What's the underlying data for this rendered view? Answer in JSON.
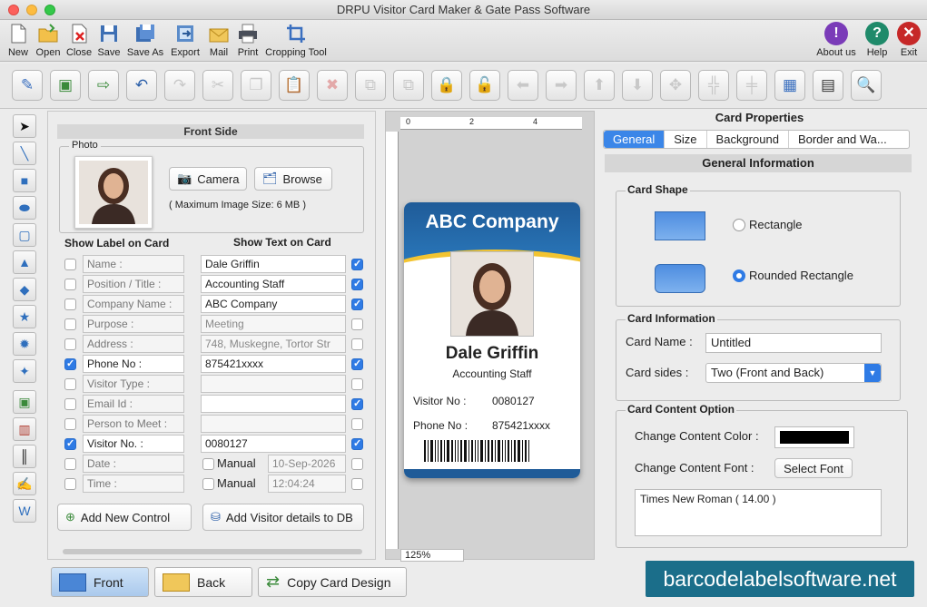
{
  "window": {
    "title": "DRPU Visitor Card Maker & Gate Pass Software"
  },
  "toolbar": {
    "new": "New",
    "open": "Open",
    "close": "Close",
    "save": "Save",
    "save_as": "Save As",
    "export": "Export",
    "mail": "Mail",
    "print": "Print",
    "cropping_tool": "Cropping Tool",
    "about_us": "About us",
    "help": "Help",
    "exit": "Exit"
  },
  "left_panel": {
    "front_side": "Front Side",
    "photo_legend": "Photo",
    "camera_btn": "Camera",
    "browse_btn": "Browse",
    "max_size": "( Maximum Image Size: 6 MB )",
    "show_label_header": "Show Label on Card",
    "show_text_header": "Show Text on Card",
    "rows": [
      {
        "label": "Name :",
        "value": "Dale Griffin",
        "label_checked": false,
        "text_checked": true
      },
      {
        "label": "Position / Title :",
        "value": "Accounting Staff",
        "label_checked": false,
        "text_checked": true
      },
      {
        "label": "Company Name :",
        "value": "ABC Company",
        "label_checked": false,
        "text_checked": true
      },
      {
        "label": "Purpose :",
        "value": "Meeting",
        "label_checked": false,
        "text_checked": false
      },
      {
        "label": "Address :",
        "value": "748, Muskegne, Tortor Str",
        "label_checked": false,
        "text_checked": false
      },
      {
        "label": "Phone No :",
        "value": "875421xxxx",
        "label_checked": true,
        "text_checked": true
      },
      {
        "label": "Visitor Type :",
        "value": "",
        "label_checked": false,
        "text_checked": false
      },
      {
        "label": "Email Id :",
        "value": "",
        "label_checked": false,
        "text_checked": true
      },
      {
        "label": "Person to Meet :",
        "value": "",
        "label_checked": false,
        "text_checked": false
      },
      {
        "label": "Visitor No. :",
        "value": "0080127",
        "label_checked": true,
        "text_checked": true
      },
      {
        "label": "Date :",
        "value": "10-Sep-2026",
        "manual": "Manual",
        "label_checked": false,
        "text_checked": false
      },
      {
        "label": "Time :",
        "value": "12:04:24",
        "manual": "Manual",
        "label_checked": false,
        "text_checked": false
      }
    ],
    "add_control_btn": "Add New Control",
    "add_visitor_btn": "Add Visitor details to DB"
  },
  "canvas": {
    "ruler_marks": [
      "0",
      "2",
      "4"
    ],
    "zoom": "125%",
    "card": {
      "company": "ABC Company",
      "name": "Dale Griffin",
      "role": "Accounting Staff",
      "visitor_label": "Visitor No :",
      "visitor_value": "0080127",
      "phone_label": "Phone No :",
      "phone_value": "875421xxxx"
    }
  },
  "right_panel": {
    "title": "Card Properties",
    "tabs": [
      "General",
      "Size",
      "Background",
      "Border and Wa..."
    ],
    "section_header": "General Information",
    "card_shape_legend": "Card Shape",
    "rectangle": "Rectangle",
    "rounded_rectangle": "Rounded Rectangle",
    "selected_shape": "Rounded Rectangle",
    "card_info_legend": "Card Information",
    "card_name_label": "Card Name :",
    "card_name_value": "Untitled",
    "card_sides_label": "Card sides :",
    "card_sides_value": "Two (Front and Back)",
    "content_legend": "Card Content Option",
    "content_color_label": "Change Content Color :",
    "content_color": "#000000",
    "content_font_label": "Change Content Font :",
    "select_font_btn": "Select Font",
    "font_value": "Times New Roman ( 14.00 )"
  },
  "bottom": {
    "front_btn": "Front",
    "back_btn": "Back",
    "copy_btn": "Copy Card Design",
    "brand": "barcodelabelsoftware.net"
  },
  "colors": {
    "accent": "#2f7be5",
    "card_blue": "#1f5b98",
    "brand_bg": "#1b6e8a"
  }
}
